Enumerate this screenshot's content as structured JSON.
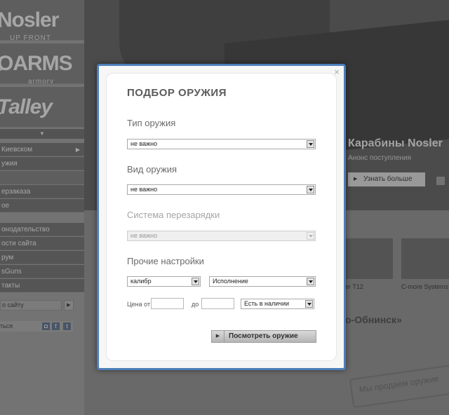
{
  "background": {
    "brands": [
      {
        "label": "Nosler",
        "sub": "UP FRONT"
      },
      {
        "label": "OARMS",
        "sub": "armory"
      },
      {
        "label": "Talley",
        "sub": ""
      }
    ],
    "nav_top": [
      "Киевском",
      "ужия"
    ],
    "nav_mid": [
      "ерзаказа",
      "ое"
    ],
    "nav_bottom": [
      "онодательство",
      "ости сайта",
      "рум",
      "sGuns",
      "такты"
    ],
    "hero_title": "Карабины Nosler",
    "hero_subtitle": "Анонс поступления",
    "hero_button": "Узнать больше",
    "search_text": "о сайту",
    "social_text": "ться",
    "captions": [
      "er T12",
      "C-more Systems"
    ],
    "heading": "о-Обнинск»",
    "stamp": "Мы продаем оружие"
  },
  "modal": {
    "title": "ПОДБОР ОРУЖИЯ",
    "weapon_type": {
      "label": "Тип оружия",
      "value": "не важно"
    },
    "weapon_kind": {
      "label": "Вид оружия",
      "value": "не важно"
    },
    "reload_system": {
      "label": "Система перезарядки",
      "value": "не важно"
    },
    "other": {
      "label": "Прочие настройки",
      "caliber": "калибр",
      "version": "Исполнение",
      "price_from": "Цена от",
      "price_to": "до",
      "availability": "Есть в наличии"
    },
    "submit": "Посмотреть  оружие",
    "close": "×"
  },
  "colors": {
    "frame": "#4d7fba",
    "title": "#5b5b5b"
  }
}
